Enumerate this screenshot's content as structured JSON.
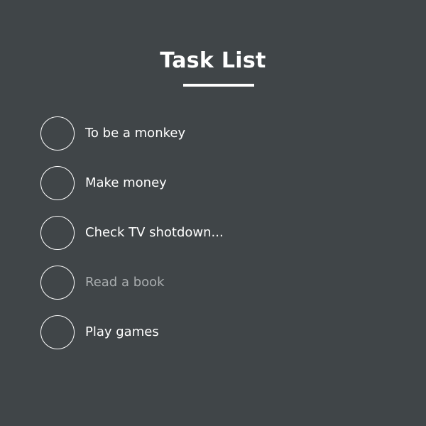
{
  "header": {
    "title": "Task List"
  },
  "tasks": [
    {
      "label": "To be a monkey",
      "done": false,
      "muted": false
    },
    {
      "label": "Make money",
      "done": false,
      "muted": false
    },
    {
      "label": "Check TV shotdown...",
      "done": false,
      "muted": false
    },
    {
      "label": "Read a book",
      "done": false,
      "muted": true
    },
    {
      "label": "Play games",
      "done": false,
      "muted": false
    }
  ],
  "colors": {
    "background": "#404548",
    "text": "#ffffff",
    "muted_text": "#a9adaf"
  }
}
